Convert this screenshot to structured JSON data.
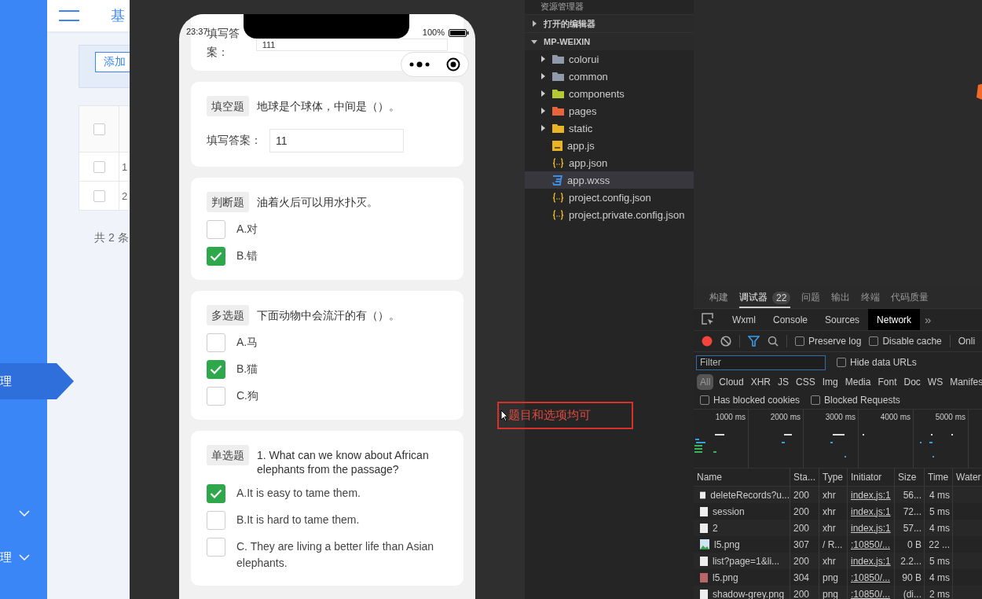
{
  "admin": {
    "title": "基",
    "add_button": "添加",
    "header_checked": false,
    "rows": [
      {
        "checked": false,
        "cell": "1"
      },
      {
        "checked": false,
        "cell": "2"
      }
    ],
    "pagination": "共 2 条",
    "sidebar": [
      {
        "label": "理",
        "selected": true,
        "expandable": false
      },
      {
        "selected": false,
        "expandable": true
      },
      {
        "label": "理",
        "selected": false,
        "expandable": true
      }
    ]
  },
  "phone": {
    "time": "23:37",
    "battery": "100%",
    "questions": [
      {
        "kind": "fill",
        "answer_label": "填写答案：",
        "answer": "111"
      },
      {
        "kind": "fill",
        "tag": "填空题",
        "question": "地球是个球体，中间是（）。",
        "answer_label": "填写答案：",
        "answer": "11"
      },
      {
        "kind": "choice",
        "tag": "判断题",
        "question": "油着火后可以用水扑灭。",
        "options": [
          {
            "label": "A.对",
            "checked": false
          },
          {
            "label": "B.错",
            "checked": true
          }
        ]
      },
      {
        "kind": "choice",
        "tag": "多选题",
        "question": "下面动物中会流汗的有（）。",
        "options": [
          {
            "label": "A.马",
            "checked": false
          },
          {
            "label": "B.猫",
            "checked": true
          },
          {
            "label": "C.狗",
            "checked": false
          }
        ]
      },
      {
        "kind": "choice",
        "tag": "单选题",
        "question": "1. What can we know about African elephants from the passage?",
        "options": [
          {
            "label": "A.It is easy to tame them.",
            "checked": true
          },
          {
            "label": "B.It is hard to tame them.",
            "checked": false
          },
          {
            "label": "C. They are living a better life than Asian elephants.",
            "checked": false
          }
        ]
      }
    ]
  },
  "annotation": {
    "text": "题目和选项均可"
  },
  "explorer": {
    "title": "资源管理器",
    "sections": [
      {
        "label": "打开的编辑器",
        "expanded": false
      },
      {
        "label": "MP-WEIXIN",
        "expanded": true,
        "children": [
          {
            "kind": "folder",
            "label": "colorui",
            "color": "#8f9ba8",
            "expanded": false,
            "selected": false
          },
          {
            "kind": "folder",
            "label": "common",
            "color": "#8f9ba8",
            "expanded": false,
            "selected": false
          },
          {
            "kind": "folder",
            "label": "components",
            "color": "#b5c934",
            "expanded": false,
            "selected": false
          },
          {
            "kind": "folder",
            "label": "pages",
            "color": "#e8643c",
            "expanded": false,
            "selected": false
          },
          {
            "kind": "folder",
            "label": "static",
            "color": "#e9b527",
            "expanded": false,
            "selected": false
          },
          {
            "kind": "js",
            "label": "app.js",
            "selected": false
          },
          {
            "kind": "json",
            "label": "app.json",
            "selected": false
          },
          {
            "kind": "css",
            "label": "app.wxss",
            "selected": true
          },
          {
            "kind": "json",
            "label": "project.config.json",
            "selected": false
          },
          {
            "kind": "json",
            "label": "project.private.config.json",
            "selected": false
          }
        ]
      }
    ]
  },
  "devtools": {
    "top_tabs": [
      {
        "label": "构建",
        "selected": false
      },
      {
        "label": "调试器",
        "selected": true,
        "badge": "22"
      },
      {
        "label": "问题",
        "selected": false
      },
      {
        "label": "输出",
        "selected": false
      },
      {
        "label": "终端",
        "selected": false
      },
      {
        "label": "代码质量",
        "selected": false
      }
    ],
    "panel_tabs": [
      {
        "label": "Wxml",
        "selected": false
      },
      {
        "label": "Console",
        "selected": false
      },
      {
        "label": "Sources",
        "selected": false
      },
      {
        "label": "Network",
        "selected": true
      }
    ],
    "more": "»",
    "recording": true,
    "preserve_log": {
      "label": "Preserve log",
      "checked": false
    },
    "disable_cache": {
      "label": "Disable cache",
      "checked": false
    },
    "throttle": "Onli",
    "filter": {
      "placeholder": "Filter"
    },
    "hide_data_urls": {
      "label": "Hide data URLs",
      "checked": false
    },
    "types": [
      {
        "label": "All",
        "selected": true
      },
      {
        "label": "Cloud",
        "selected": false
      },
      {
        "label": "XHR",
        "selected": false
      },
      {
        "label": "JS",
        "selected": false
      },
      {
        "label": "CSS",
        "selected": false
      },
      {
        "label": "Img",
        "selected": false
      },
      {
        "label": "Media",
        "selected": false
      },
      {
        "label": "Font",
        "selected": false
      },
      {
        "label": "Doc",
        "selected": false
      },
      {
        "label": "WS",
        "selected": false
      },
      {
        "label": "Manifes",
        "selected": false
      }
    ],
    "blocked_cookies": {
      "label": "Has blocked cookies",
      "checked": false
    },
    "blocked_requests": {
      "label": "Blocked Requests",
      "checked": false
    },
    "ticks": [
      "1000 ms",
      "2000 ms",
      "3000 ms",
      "4000 ms",
      "5000 ms"
    ],
    "columns": [
      "Name",
      "Sta...",
      "Type",
      "Initiator",
      "Size",
      "Time",
      "Water"
    ],
    "rows": [
      {
        "kind": "doc",
        "name": "deleteRecords?u...",
        "status": "200",
        "type": "xhr",
        "initiator": "index.js:1",
        "size": "56...",
        "time": "4 ms"
      },
      {
        "kind": "doc",
        "name": "session",
        "status": "200",
        "type": "xhr",
        "initiator": "index.js:1",
        "size": "72...",
        "time": "5 ms"
      },
      {
        "kind": "doc",
        "name": "2",
        "status": "200",
        "type": "xhr",
        "initiator": "index.js:1",
        "size": "57...",
        "time": "4 ms"
      },
      {
        "kind": "image",
        "name": "l5.png",
        "status": "307",
        "type": "/ R...",
        "initiator": ":10850/...",
        "size": "0 B",
        "time": "22 ..."
      },
      {
        "kind": "doc",
        "name": "list?page=1&li...",
        "status": "200",
        "type": "xhr",
        "initiator": "index.js:1",
        "size": "2.2...",
        "time": "5 ms"
      },
      {
        "kind": "broken",
        "name": "l5.png",
        "status": "304",
        "type": "png",
        "initiator": ":10850/...",
        "size": "90 B",
        "time": "4 ms"
      },
      {
        "kind": "doc",
        "name": "shadow-grey.png",
        "status": "200",
        "type": "png",
        "initiator": ":10850/...",
        "size": "(di...",
        "time": "2 ms"
      }
    ]
  }
}
